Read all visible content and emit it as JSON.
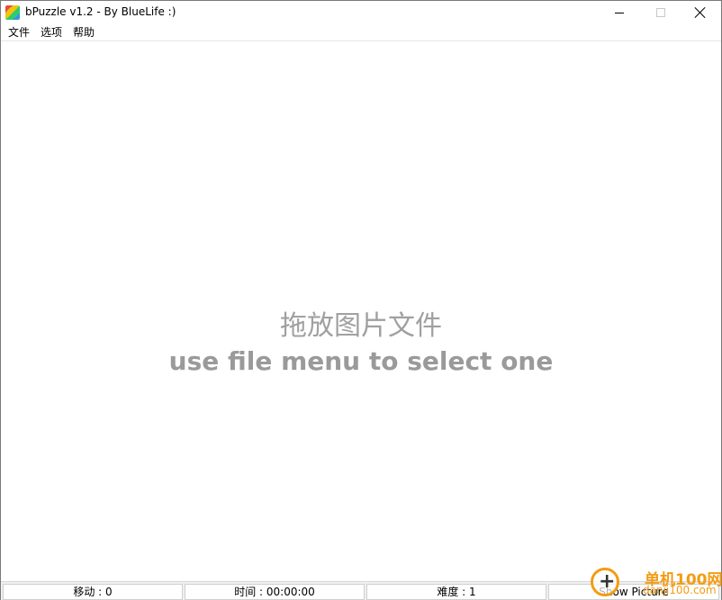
{
  "window": {
    "title": "bPuzzle v1.2 - By BlueLife :)",
    "icon": "puzzle-app-icon"
  },
  "menu": {
    "items": [
      {
        "label": "文件"
      },
      {
        "label": "选项"
      },
      {
        "label": "帮助"
      }
    ]
  },
  "canvas": {
    "hint_cn": "拖放图片文件",
    "hint_en": "use file menu to select one"
  },
  "status": {
    "moves": "移动 : 0",
    "time": "时间 : 00:00:00",
    "difficulty": "难度 : 1",
    "show_picture": "Show Picture"
  },
  "watermark": {
    "text1": "单机100网",
    "text2": "danji100.com"
  },
  "colors": {
    "hint_text": "#a0a0a0",
    "watermark": "#f39c12"
  }
}
